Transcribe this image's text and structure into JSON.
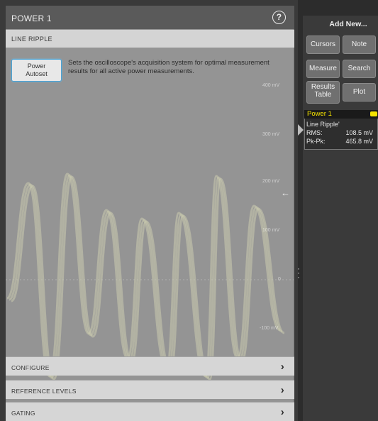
{
  "panel": {
    "title": "POWER 1",
    "help_icon": "help-circle-icon",
    "section": "LINE RIPPLE",
    "autoset_button": "Power\nAutoset",
    "autoset_description": "Sets the oscilloscope's acquisition system for optimal measurement results for all active power measurements.",
    "rows": [
      {
        "label": "CONFIGURE"
      },
      {
        "label": "REFERENCE LEVELS"
      },
      {
        "label": "GATING"
      }
    ],
    "chevron": "›"
  },
  "scope": {
    "y_ticks": [
      "400 mV",
      "300 mV",
      "200 mV",
      "100 mV",
      "0",
      "-100 mV"
    ],
    "waveform_color": "#b9bb7a",
    "ground_marker": "←"
  },
  "sidebar": {
    "add_new_label": "Add New...",
    "buttons": {
      "cursors": "Cursors",
      "note": "Note",
      "measure": "Measure",
      "search": "Search",
      "results_table": "Results\nTable",
      "plot": "Plot"
    }
  },
  "badge": {
    "title": "Power 1",
    "measurement": "Line Ripple'",
    "rms_label": "RMS:",
    "rms_value": "108.5 mV",
    "pkpk_label": "Pk-Pk:",
    "pkpk_value": "465.8 mV",
    "accent_color": "#f5e300"
  }
}
